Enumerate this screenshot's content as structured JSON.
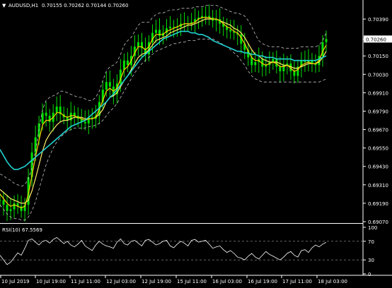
{
  "window": {
    "symbol_header": "AUDUSD,H1",
    "ohlc": "0.70155 0.70262 0.70144 0.70260"
  },
  "colors": {
    "background": "#000000",
    "grid": "#3a3a3a",
    "axis": "#ffffff",
    "candles": "#00e000",
    "ma_fast": "#ffcc00",
    "ma_mid": "#ffee66",
    "ma_slow": "#22d3d3",
    "bollinger": "#c0c0c0",
    "rsi": "#ffffff",
    "price_tag": "#ffffff"
  },
  "chart_data": [
    {
      "type": "line",
      "instrument": "AUDUSD",
      "timeframe": "H1",
      "y_ticks": [
        "0.70390",
        "0.70260",
        "0.70150",
        "0.70030",
        "0.69910",
        "0.69790",
        "0.69670",
        "0.69550",
        "0.69430",
        "0.69310",
        "0.69190",
        "0.69070"
      ],
      "ylim": [
        0.6907,
        0.7045
      ],
      "current_price": "0.70260",
      "x_ticks": [
        "10 Jul 2019",
        "10 Jul 19:00",
        "11 Jul 11:00",
        "12 Jul 03:00",
        "12 Jul 19:00",
        "15 Jul 11:00",
        "16 Jul 03:00",
        "16 Jul 19:00",
        "17 Jul 11:00",
        "18 Jul 03:00"
      ],
      "x": [
        0,
        5,
        10,
        15,
        20,
        25,
        30,
        35,
        40,
        45,
        50,
        55,
        60,
        65,
        70,
        75,
        80,
        85,
        90,
        95,
        100,
        105,
        110,
        115,
        120,
        125,
        130,
        135,
        140,
        145,
        150,
        155,
        160,
        165,
        170,
        175,
        180,
        185,
        190,
        195,
        200,
        205,
        210,
        215,
        220,
        225,
        230,
        235,
        240,
        245,
        250,
        255,
        260,
        265,
        270,
        275,
        280,
        285,
        290,
        295,
        300,
        305,
        310,
        315,
        320,
        325,
        330,
        335,
        340,
        345,
        350,
        355,
        360,
        365,
        370,
        375,
        380,
        385,
        390,
        395,
        400,
        405,
        410,
        415,
        420,
        425,
        430,
        435,
        440,
        445,
        450,
        455,
        460
      ],
      "x_max": 460,
      "series": [
        {
          "name": "",
          "role": "close",
          "values": [
            0.6921,
            0.6918,
            0.6914,
            0.6915,
            0.6919,
            0.6917,
            0.6914,
            0.6918,
            0.6936,
            0.6952,
            0.6962,
            0.6971,
            0.6978,
            0.6976,
            0.6972,
            0.6978,
            0.6982,
            0.6977,
            0.6975,
            0.6973,
            0.6978,
            0.6976,
            0.6974,
            0.6972,
            0.6971,
            0.6975,
            0.6974,
            0.6976,
            0.6985,
            0.6993,
            0.6998,
            0.6995,
            0.699,
            0.6997,
            0.7006,
            0.7012,
            0.7009,
            0.7015,
            0.7021,
            0.7024,
            0.702,
            0.7016,
            0.7024,
            0.703,
            0.7032,
            0.7028,
            0.703,
            0.7033,
            0.7034,
            0.7034,
            0.7034,
            0.7036,
            0.7036,
            0.7036,
            0.7037,
            0.7039,
            0.704,
            0.7041,
            0.7041,
            0.704,
            0.7038,
            0.7039,
            0.7036,
            0.7034,
            0.7032,
            0.7031,
            0.703,
            0.7029,
            0.7023,
            0.7019,
            0.7014,
            0.7009,
            0.7011,
            0.7013,
            0.7008,
            0.7009,
            0.7011,
            0.7013,
            0.7008,
            0.7005,
            0.7009,
            0.701,
            0.7005,
            0.7002,
            0.7008,
            0.7012,
            0.7011,
            0.7012,
            0.701,
            0.7009,
            0.7015,
            0.7024,
            0.7026
          ]
        },
        {
          "name": "",
          "role": "ma_fast",
          "values": [
            0.6925,
            0.6922,
            0.6919,
            0.6917,
            0.6918,
            0.6917,
            0.6916,
            0.6917,
            0.6925,
            0.6937,
            0.6949,
            0.696,
            0.697,
            0.6973,
            0.6973,
            0.6975,
            0.6978,
            0.6978,
            0.6976,
            0.6975,
            0.6976,
            0.6976,
            0.6975,
            0.6974,
            0.6973,
            0.6974,
            0.6974,
            0.6975,
            0.698,
            0.6986,
            0.6992,
            0.6994,
            0.6992,
            0.6994,
            0.7,
            0.7006,
            0.7008,
            0.7012,
            0.7017,
            0.7021,
            0.7021,
            0.7019,
            0.7021,
            0.7026,
            0.7029,
            0.7029,
            0.7029,
            0.7031,
            0.7032,
            0.7033,
            0.7034,
            0.7035,
            0.7036,
            0.7036,
            0.7036,
            0.7037,
            0.7039,
            0.704,
            0.704,
            0.704,
            0.7039,
            0.7039,
            0.7038,
            0.7036,
            0.7034,
            0.7033,
            0.7031,
            0.703,
            0.7027,
            0.7023,
            0.7018,
            0.7014,
            0.7012,
            0.7012,
            0.701,
            0.7009,
            0.701,
            0.7011,
            0.701,
            0.7008,
            0.7008,
            0.7009,
            0.7007,
            0.7005,
            0.7006,
            0.7009,
            0.701,
            0.7011,
            0.701,
            0.701,
            0.7012,
            0.7018,
            0.7022
          ]
        },
        {
          "name": "",
          "role": "ma_mid",
          "values": [
            0.6928,
            0.6926,
            0.6924,
            0.6922,
            0.6921,
            0.692,
            0.6919,
            0.6919,
            0.6921,
            0.6927,
            0.6935,
            0.6944,
            0.6953,
            0.696,
            0.6964,
            0.6967,
            0.697,
            0.6972,
            0.6973,
            0.6973,
            0.6974,
            0.6975,
            0.6975,
            0.6975,
            0.6974,
            0.6974,
            0.6974,
            0.6975,
            0.6977,
            0.698,
            0.6985,
            0.6988,
            0.6989,
            0.6991,
            0.6995,
            0.6999,
            0.7002,
            0.7006,
            0.701,
            0.7014,
            0.7016,
            0.7017,
            0.7019,
            0.7022,
            0.7025,
            0.7026,
            0.7027,
            0.7028,
            0.703,
            0.7031,
            0.7032,
            0.7033,
            0.7034,
            0.7035,
            0.7035,
            0.7036,
            0.7037,
            0.7038,
            0.7039,
            0.7039,
            0.7039,
            0.7039,
            0.7038,
            0.7037,
            0.7036,
            0.7035,
            0.7033,
            0.7032,
            0.703,
            0.7027,
            0.7023,
            0.7019,
            0.7016,
            0.7015,
            0.7013,
            0.7012,
            0.7011,
            0.7011,
            0.7011,
            0.701,
            0.7009,
            0.7009,
            0.7008,
            0.7007,
            0.7007,
            0.7008,
            0.7009,
            0.701,
            0.701,
            0.701,
            0.7011,
            0.7014,
            0.7018
          ]
        },
        {
          "name": "",
          "role": "ma_slow",
          "values": [
            0.6954,
            0.695,
            0.6946,
            0.6943,
            0.6941,
            0.6941,
            0.6942,
            0.6943,
            0.6945,
            0.6947,
            0.6949,
            0.6951,
            0.6953,
            0.6955,
            0.6957,
            0.6959,
            0.6961,
            0.6963,
            0.6965,
            0.6967,
            0.6969,
            0.697,
            0.6971,
            0.6972,
            0.6973,
            0.6975,
            0.6977,
            0.6979,
            0.6981,
            0.6983,
            0.6985,
            0.6988,
            0.699,
            0.6993,
            0.6996,
            0.6999,
            0.7002,
            0.7005,
            0.7008,
            0.7011,
            0.7014,
            0.7016,
            0.7018,
            0.702,
            0.7022,
            0.7024,
            0.7026,
            0.7027,
            0.7028,
            0.7029,
            0.703,
            0.7031,
            0.7031,
            0.7031,
            0.703,
            0.703,
            0.7029,
            0.7029,
            0.7028,
            0.7027,
            0.7025,
            0.7024,
            0.7023,
            0.7022,
            0.7021,
            0.702,
            0.7019,
            0.7018,
            0.7018,
            0.7017,
            0.7017,
            0.7016,
            0.7016,
            0.7015,
            0.7015,
            0.7014,
            0.7014,
            0.7014,
            0.7013,
            0.7013,
            0.7013,
            0.7013,
            0.7013,
            0.7012,
            0.7012,
            0.7012,
            0.7012,
            0.7012,
            0.7012,
            0.7012,
            0.7013,
            0.7014,
            0.7015
          ]
        },
        {
          "name": "",
          "role": "bb_upper",
          "values": [
            0.6938,
            0.6937,
            0.6935,
            0.6934,
            0.6932,
            0.6931,
            0.693,
            0.6931,
            0.6935,
            0.6942,
            0.6953,
            0.6967,
            0.698,
            0.6986,
            0.6988,
            0.6989,
            0.699,
            0.6992,
            0.6992,
            0.6991,
            0.699,
            0.6989,
            0.6988,
            0.6988,
            0.6987,
            0.6986,
            0.6986,
            0.6988,
            0.6992,
            0.6999,
            0.7005,
            0.7008,
            0.7009,
            0.7011,
            0.7016,
            0.7022,
            0.7025,
            0.7027,
            0.7031,
            0.7035,
            0.7037,
            0.7037,
            0.7037,
            0.704,
            0.7042,
            0.7043,
            0.7043,
            0.7044,
            0.7045,
            0.7045,
            0.7045,
            0.7046,
            0.7046,
            0.7046,
            0.7046,
            0.7047,
            0.7047,
            0.7047,
            0.7048,
            0.7048,
            0.7048,
            0.7048,
            0.7047,
            0.7046,
            0.7045,
            0.7044,
            0.7043,
            0.7043,
            0.7042,
            0.7041,
            0.7038,
            0.7034,
            0.7029,
            0.7025,
            0.7023,
            0.7022,
            0.7021,
            0.7021,
            0.7021,
            0.7021,
            0.702,
            0.702,
            0.702,
            0.702,
            0.702,
            0.7021,
            0.7021,
            0.7021,
            0.7021,
            0.7021,
            0.7022,
            0.7025,
            0.703
          ]
        },
        {
          "name": "",
          "role": "bb_lower",
          "values": [
            0.6918,
            0.6915,
            0.6912,
            0.691,
            0.6909,
            0.6909,
            0.6908,
            0.6908,
            0.691,
            0.6914,
            0.692,
            0.6928,
            0.6936,
            0.6944,
            0.695,
            0.6955,
            0.6959,
            0.6962,
            0.6964,
            0.6966,
            0.6967,
            0.6968,
            0.6968,
            0.6968,
            0.6968,
            0.6969,
            0.6969,
            0.697,
            0.6971,
            0.6973,
            0.6976,
            0.6979,
            0.6981,
            0.6984,
            0.6988,
            0.6992,
            0.6996,
            0.7,
            0.7004,
            0.7007,
            0.701,
            0.7012,
            0.7014,
            0.7016,
            0.7018,
            0.7019,
            0.702,
            0.7021,
            0.7022,
            0.7023,
            0.7023,
            0.7024,
            0.7024,
            0.7025,
            0.7025,
            0.7025,
            0.7026,
            0.7026,
            0.7026,
            0.7026,
            0.7026,
            0.7025,
            0.7024,
            0.7022,
            0.7021,
            0.7019,
            0.7017,
            0.7015,
            0.7012,
            0.7009,
            0.7005,
            0.7002,
            0.7,
            0.6999,
            0.6998,
            0.6998,
            0.6998,
            0.6998,
            0.6998,
            0.6998,
            0.6998,
            0.6998,
            0.6998,
            0.6998,
            0.6998,
            0.6998,
            0.6998,
            0.6998,
            0.6998,
            0.6998,
            0.6998,
            0.6999,
            0.7
          ]
        }
      ]
    },
    {
      "type": "line",
      "indicator_label": "RSI(10) 67.5569",
      "ylim": [
        0,
        100
      ],
      "levels": [
        30,
        70
      ],
      "y_ticks": [
        "100",
        "70",
        "30",
        "0"
      ],
      "x": [
        0,
        5,
        10,
        15,
        20,
        25,
        30,
        35,
        40,
        45,
        50,
        55,
        60,
        65,
        70,
        75,
        80,
        85,
        90,
        95,
        100,
        105,
        110,
        115,
        120,
        125,
        130,
        135,
        140,
        145,
        150,
        155,
        160,
        165,
        170,
        175,
        180,
        185,
        190,
        195,
        200,
        205,
        210,
        215,
        220,
        225,
        230,
        235,
        240,
        245,
        250,
        255,
        260,
        265,
        270,
        275,
        280,
        285,
        290,
        295,
        300,
        305,
        310,
        315,
        320,
        325,
        330,
        335,
        340,
        345,
        350,
        355,
        360,
        365,
        370,
        375,
        380,
        385,
        390,
        395,
        400,
        405,
        410,
        415,
        420,
        425,
        430,
        435,
        440,
        445,
        450,
        455,
        460
      ],
      "series": [
        {
          "name": "",
          "values": [
            40,
            30,
            20,
            25,
            35,
            45,
            40,
            55,
            72,
            75,
            68,
            62,
            70,
            72,
            66,
            74,
            78,
            72,
            65,
            70,
            62,
            58,
            64,
            72,
            60,
            55,
            50,
            62,
            70,
            64,
            60,
            58,
            55,
            68,
            75,
            65,
            62,
            70,
            72,
            66,
            60,
            72,
            74,
            68,
            62,
            65,
            70,
            72,
            60,
            56,
            64,
            70,
            66,
            60,
            72,
            74,
            68,
            70,
            72,
            64,
            55,
            58,
            60,
            52,
            46,
            50,
            44,
            36,
            34,
            30,
            38,
            44,
            36,
            32,
            40,
            48,
            42,
            38,
            34,
            30,
            36,
            44,
            48,
            40,
            36,
            50,
            52,
            46,
            56,
            62,
            58,
            64,
            67.6
          ]
        }
      ]
    }
  ]
}
